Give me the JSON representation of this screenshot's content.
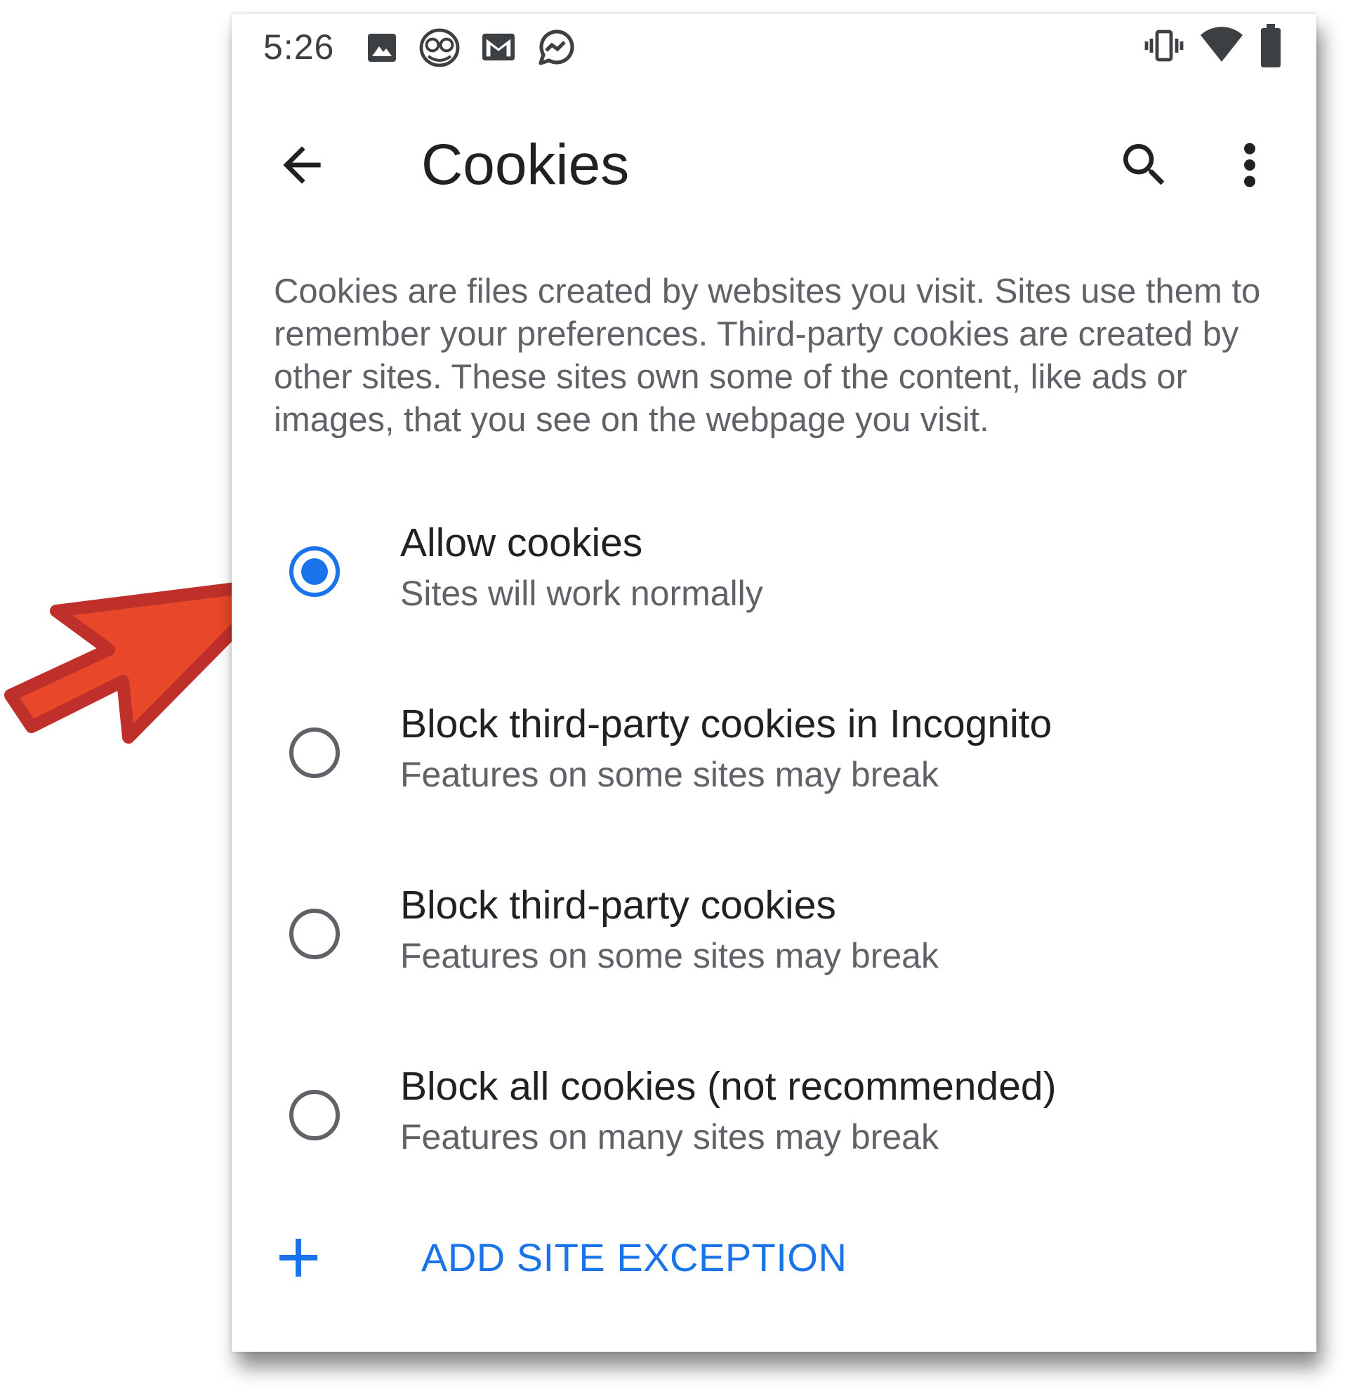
{
  "status_bar": {
    "time": "5:26",
    "left_icons": [
      "image-icon",
      "owl-icon",
      "gmail-icon",
      "signal-app-icon"
    ],
    "right_icons": [
      "vibrate-icon",
      "wifi-icon",
      "battery-icon"
    ]
  },
  "toolbar": {
    "title": "Cookies",
    "back_icon": "arrow-back-icon",
    "search_icon": "search-icon",
    "more_icon": "more-vert-icon"
  },
  "description": "Cookies are files created by websites you visit. Sites use them to remember your preferences. Third-party cookies are created by other sites. These sites own some of the content, like ads or images, that you see on the webpage you visit.",
  "options": [
    {
      "title": "Allow cookies",
      "subtitle": "Sites will work normally",
      "selected": true
    },
    {
      "title": "Block third-party cookies in Incognito",
      "subtitle": "Features on some sites may break",
      "selected": false
    },
    {
      "title": "Block third-party cookies",
      "subtitle": "Features on some sites may break",
      "selected": false
    },
    {
      "title": "Block all cookies (not recommended)",
      "subtitle": "Features on many sites may break",
      "selected": false
    }
  ],
  "add_exception": {
    "label": "ADD SITE EXCEPTION",
    "icon": "plus-icon"
  },
  "colors": {
    "accent": "#1a73e8",
    "radio_off": "#5f6368",
    "annotation_fill": "#e8472a",
    "annotation_stroke": "#c0302a"
  }
}
